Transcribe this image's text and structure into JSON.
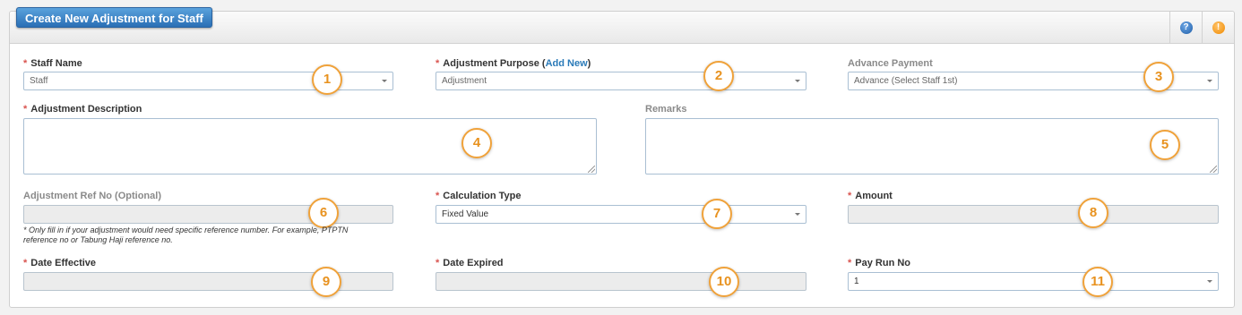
{
  "header": {
    "title": "Create New Adjustment for Staff",
    "help_icon": "?",
    "info_icon": "!"
  },
  "form": {
    "staff_name": {
      "label": "Staff Name",
      "value": "Staff",
      "badge": "1"
    },
    "adjustment_purpose": {
      "label_prefix": "Adjustment Purpose (",
      "add_new": "Add New",
      "label_suffix": ")",
      "value": "Adjustment",
      "badge": "2"
    },
    "advance_payment": {
      "label": "Advance Payment",
      "value": "Advance (Select Staff 1st)",
      "badge": "3"
    },
    "adjustment_description": {
      "label": "Adjustment Description",
      "badge": "4"
    },
    "remarks": {
      "label": "Remarks",
      "badge": "5"
    },
    "adjustment_ref_no": {
      "label": "Adjustment Ref No (Optional)",
      "value": "",
      "badge": "6",
      "note": "* Only fill in if your adjustment would need specific reference number. For example, PTPTN reference no or Tabung Haji reference no."
    },
    "calculation_type": {
      "label": "Calculation Type",
      "value": "Fixed Value",
      "badge": "7"
    },
    "amount": {
      "label": "Amount",
      "value": "",
      "badge": "8"
    },
    "date_effective": {
      "label": "Date Effective",
      "value": "",
      "badge": "9"
    },
    "date_expired": {
      "label": "Date Expired",
      "value": "",
      "badge": "10"
    },
    "pay_run_no": {
      "label": "Pay Run No",
      "value": "1",
      "badge": "11"
    },
    "required_mark": "*"
  }
}
